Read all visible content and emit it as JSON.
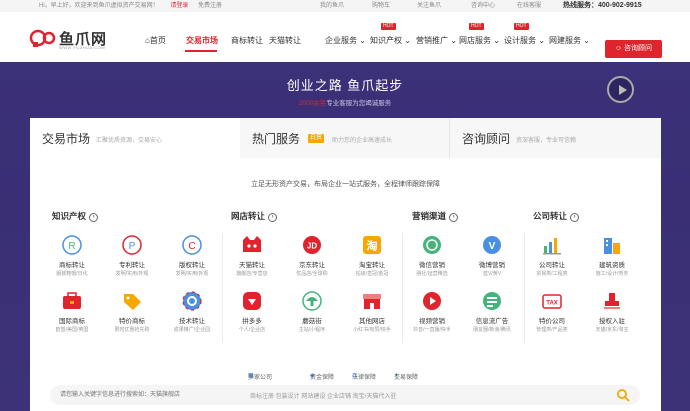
{
  "topbar": {
    "greeting": "Hi，早上好，欢迎来到鱼爪虚拟资产交易网！",
    "login": "请登录",
    "register": "免费注册",
    "links": [
      "我的鱼爪",
      "购物车",
      "关注鱼爪",
      "咨询中心",
      "在线客服"
    ],
    "hotline": "热线服务：400-902-9915"
  },
  "logo": {
    "name": "鱼爪网",
    "sub": "WWW.YUZHUA.COM"
  },
  "nav": {
    "items": [
      {
        "label": "首页"
      },
      {
        "label": "交易市场"
      },
      {
        "label": "商标转让"
      },
      {
        "label": "天猫转让"
      },
      {
        "label": "企业服务 ⌄"
      },
      {
        "label": "知识产权 ⌄",
        "badge": "HOT"
      },
      {
        "label": "营销推广 ⌄"
      },
      {
        "label": "网店服务 ⌄",
        "badge": "HOT"
      },
      {
        "label": "设计服务 ⌄",
        "badge": "HOT"
      },
      {
        "label": "网建服务 ⌄"
      }
    ],
    "consult_button": "咨询顾问"
  },
  "hero": {
    "title": "创业之路 鱼爪起步",
    "subtitle_num": "2000余名",
    "subtitle_rest": "专业客服为您竭诚服务"
  },
  "tabs": [
    {
      "name": "交易市场",
      "desc": "汇聚优质资源，交易安心"
    },
    {
      "name": "热门服务",
      "badge": "白赏",
      "desc": "助力您的企业高速成长"
    },
    {
      "name": "咨询顾问",
      "desc": "资深客服，专业可信赖"
    }
  ],
  "intro": "立足无形资产交易，布局企业一站式服务，全程律师跟踪保障",
  "columns": [
    {
      "title": "知识产权",
      "items": [
        {
          "name": "商标转让",
          "desc": "服装鞋帽/日化"
        },
        {
          "name": "专利转让",
          "desc": "发明/实用/外观"
        },
        {
          "name": "版权转让",
          "desc": "发明/实用/外观"
        },
        {
          "name": "国际商标",
          "desc": "欧盟/美国/英国"
        },
        {
          "name": "特价商标",
          "desc": "限时优惠抢先购"
        },
        {
          "name": "技术转让",
          "desc": "成果推广/企业园"
        }
      ]
    },
    {
      "title": "网店转让",
      "items": [
        {
          "name": "天猫转让",
          "desc": "旗舰店/专营店"
        },
        {
          "name": "京东转让",
          "desc": "优品店/全球购"
        },
        {
          "name": "淘宝转让",
          "desc": "钻级/皇冠/金冠"
        },
        {
          "name": "拼多多",
          "desc": "个人/企业店"
        },
        {
          "name": "蘑菇街",
          "desc": "主站/小程序"
        },
        {
          "name": "其他网店",
          "desc": "小红书/有赞/快手"
        }
      ]
    },
    {
      "title": "营销渠道",
      "items": [
        {
          "name": "微信营销",
          "desc": "朋社/运营精选"
        },
        {
          "name": "微博营销",
          "desc": "蓝V/黄V"
        },
        {
          "name": "视频营销",
          "desc": "抖音/一直播/快手"
        },
        {
          "name": "信息流广告",
          "desc": "朋友圈/新浪/腾讯"
        }
      ]
    },
    {
      "title": "公司转让",
      "items": [
        {
          "name": "公司转让",
          "desc": "贸易类/工程类"
        },
        {
          "name": "建筑资质",
          "desc": "施工/设计/劳务"
        },
        {
          "name": "特价公司",
          "desc": "管理类/产品类"
        },
        {
          "name": "授权入驻",
          "desc": "天猫/京东/淘宝"
        }
      ]
    }
  ],
  "footer_links": [
    "多家公司",
    "资金保障",
    "法律保障",
    "交易保障"
  ],
  "search": {
    "placeholder": "请您输入关键字信息进行搜索如：天猫旗舰店",
    "hints": "商标注册    包装设计    网站建设    企业店铺    淘宝/天猫代入驻"
  },
  "colors": {
    "accent": "#e0242e",
    "hero": "#3b3178",
    "hot": "#f7a700"
  }
}
